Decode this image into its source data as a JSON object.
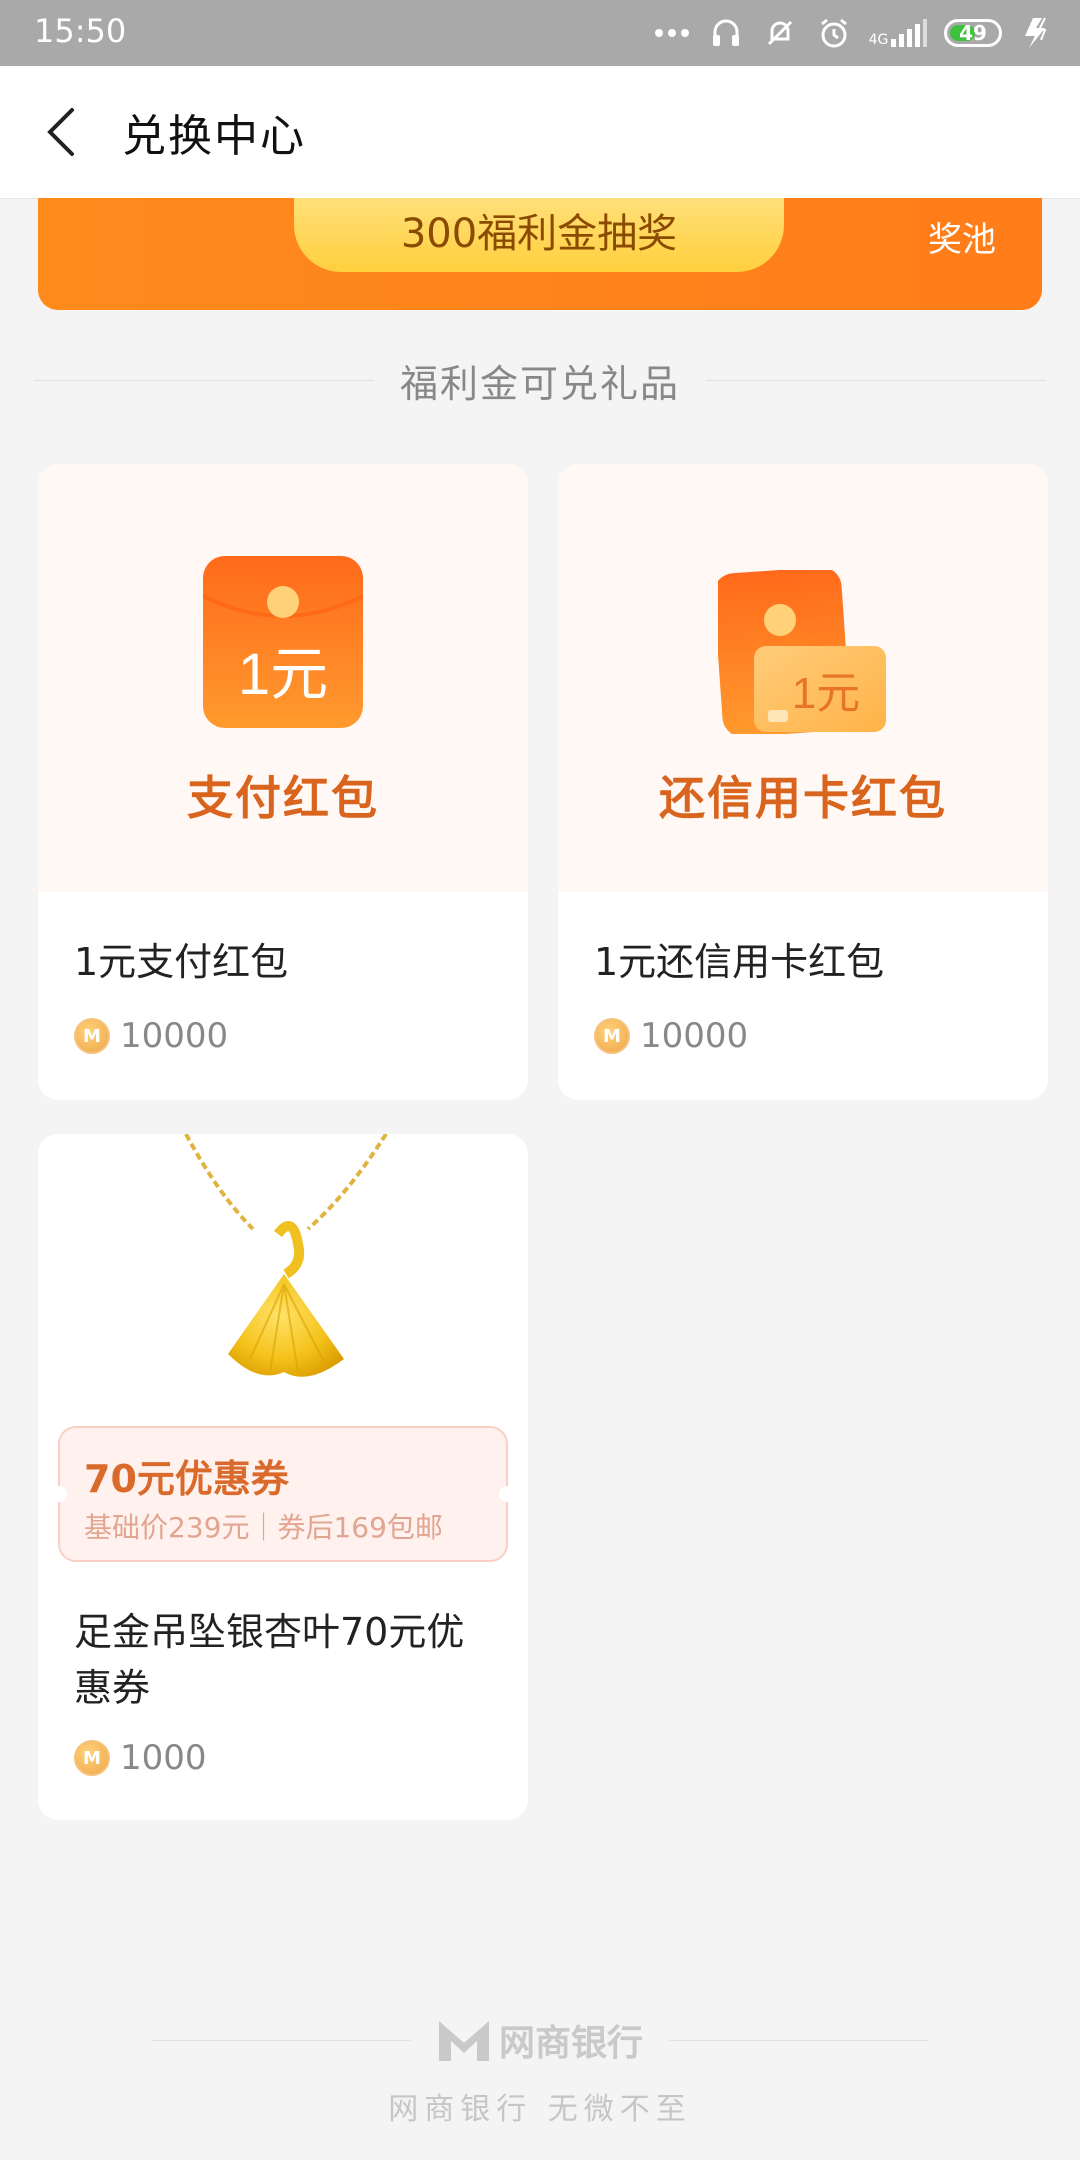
{
  "status_bar": {
    "time": "15:50",
    "network": "4G",
    "battery": "49",
    "icons": [
      "more-dots-icon",
      "headphone-icon",
      "mute-bell-icon",
      "alarm-icon",
      "signal-icon",
      "battery-icon",
      "charging-icon"
    ]
  },
  "header": {
    "title": "兑换中心",
    "back_icon": "chevron-left-icon"
  },
  "banner": {
    "pill_label": "300福利金抽奖",
    "right_label": "奖池"
  },
  "section": {
    "title": "福利金可兑礼品"
  },
  "products": [
    {
      "image_caption": "支付红包",
      "image_badge": "1元",
      "name": "1元支付红包",
      "price": "10000"
    },
    {
      "image_caption": "还信用卡红包",
      "image_badge": "1元",
      "name": "1元还信用卡红包",
      "price": "10000"
    },
    {
      "coupon_title": "70元优惠券",
      "coupon_sub": "基础价239元｜券后169包邮",
      "name": "足金吊坠银杏叶70元优惠券",
      "price": "1000"
    }
  ],
  "footer": {
    "brand": "网商银行",
    "slogan": "网商银行 无微不至"
  },
  "colors": {
    "accent_orange": "#ff8a1c",
    "caption_orange": "#d8641e",
    "background": "#f4f4f4"
  }
}
